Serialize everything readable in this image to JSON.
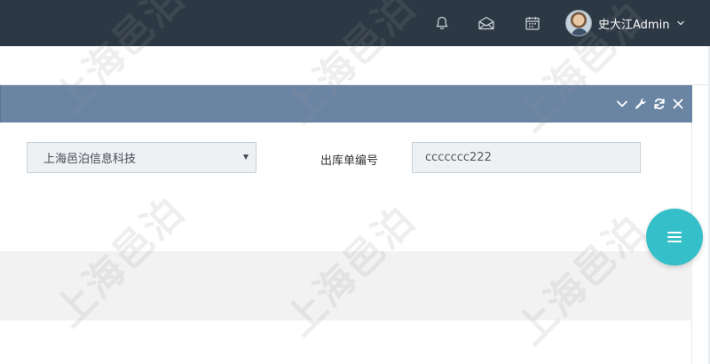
{
  "header": {
    "user_name": "史大江Admin",
    "icons": [
      "bell-icon",
      "envelope-icon",
      "calendar-icon",
      "chevron-down-icon"
    ]
  },
  "panel": {
    "tools": [
      "chevron-down-icon",
      "wrench-icon",
      "refresh-icon",
      "close-icon"
    ]
  },
  "form": {
    "company_select_value": "上海邑泊信息科技",
    "order_no_label": "出库单编号",
    "order_no_value": "ccccccc222"
  },
  "fab": {
    "icon": "menu-icon"
  },
  "watermark": {
    "text": "上海邑泊"
  },
  "colors": {
    "topbar": "#2d3845",
    "panel_header": "#6a84a3",
    "fab": "#34bfc9",
    "input_bg": "#eef1f4"
  }
}
